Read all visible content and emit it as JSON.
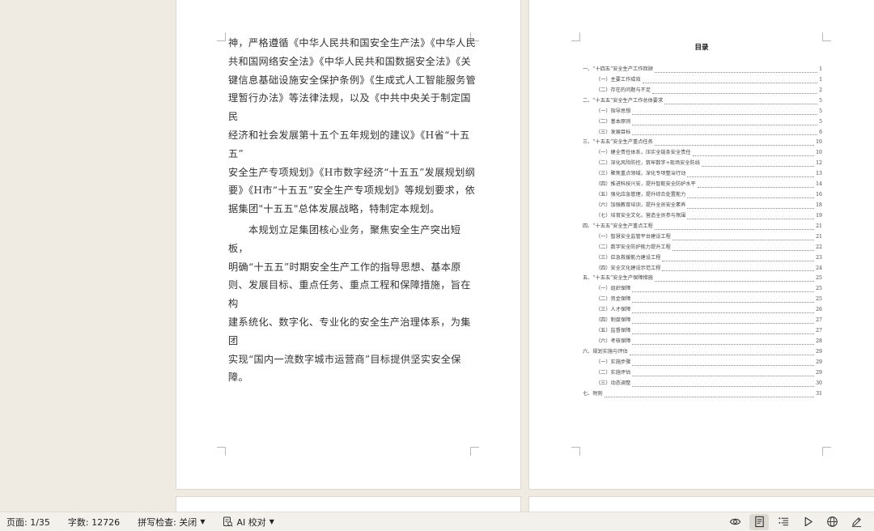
{
  "document": {
    "left_page": {
      "paragraphs": [
        "神，严格遵循《中华人民共和国安全生产法》《中华人民共和国网络安全法》《中华人民共和国数据安全法》《关键信息基础设施安全保护条例》《生成式人工智能服务管理暂行办法》等法律法规，以及《中共中央关于制定国民经济和社会发展第十五个五年规划的建议》《H省“十五五”安全生产专项规划》《H市数字经济“十五五”发展规划纲要》《H市“十五五”安全生产专项规划》等规划要求，依据集团\"十五五\"总体发展战略，特制定本规划。",
        "　　本规划立足集团核心业务，聚焦安全生产突出短板，明确“十五五”时期安全生产工作的指导思想、基本原则、发展目标、重点任务、重点工程和保障措施，旨在构建系统化、数字化、专业化的安全生产治理体系，为集团实现“国内一流数字城市运营商”目标提供坚实安全保障。"
      ],
      "lines": [
        "神，严格遵循《中华人民共和国安全生产法》《中华人民",
        "共和国网络安全法》《中华人民共和国数据安全法》《关",
        "键信息基础设施安全保护条例》《生成式人工智能服务管",
        "理暂行办法》等法律法规，以及《中共中央关于制定国民",
        "经济和社会发展第十五个五年规划的建议》《H省“十五五”",
        "安全生产专项规划》《H市数字经济“十五五”发展规划纲",
        "要》《H市“十五五”安全生产专项规划》等规划要求，依",
        "据集团\"十五五\"总体发展战略，特制定本规划。",
        "　　本规划立足集团核心业务，聚焦安全生产突出短板，",
        "明确“十五五”时期安全生产工作的指导思想、基本原",
        "则、发展目标、重点任务、重点工程和保障措施，旨在构",
        "建系统化、数字化、专业化的安全生产治理体系，为集团",
        "实现“国内一流数字城市运营商”目标提供坚实安全保",
        "障。"
      ]
    },
    "right_page": {
      "toc_title": "目录",
      "toc": [
        {
          "label": "一、“十四五”安全生产工作回顾",
          "page": "1",
          "level": 1
        },
        {
          "label": "（一）主要工作成效",
          "page": "1",
          "level": 2
        },
        {
          "label": "（二）存在的问题与不足",
          "page": "2",
          "level": 2
        },
        {
          "label": "二、“十五五”安全生产工作总体要求",
          "page": "5",
          "level": 1
        },
        {
          "label": "（一）指导思想",
          "page": "5",
          "level": 2
        },
        {
          "label": "（二）基本原则",
          "page": "5",
          "level": 2
        },
        {
          "label": "（三）发展目标",
          "page": "6",
          "level": 2
        },
        {
          "label": "三、“十五五”安全生产重点任务",
          "page": "10",
          "level": 1
        },
        {
          "label": "（一）健全责任体系，压实全链条安全责任",
          "page": "10",
          "level": 2
        },
        {
          "label": "（二）深化风险防控，筑牢数字+现场安全防线",
          "page": "12",
          "level": 2
        },
        {
          "label": "（三）聚焦重点领域，深化专项整治行动",
          "page": "13",
          "level": 2
        },
        {
          "label": "（四）推进科技兴安，提升智能安全防护水平",
          "page": "14",
          "level": 2
        },
        {
          "label": "（五）强化应急管理，提升综合处置能力",
          "page": "16",
          "level": 2
        },
        {
          "label": "（六）加强教育培训，提升全员安全素养",
          "page": "18",
          "level": 2
        },
        {
          "label": "（七）培育安全文化，营造全员参与氛围",
          "page": "19",
          "level": 2
        },
        {
          "label": "四、“十五五”安全生产重点工程",
          "page": "21",
          "level": 1
        },
        {
          "label": "（一）智慧安全监管平台建设工程",
          "page": "21",
          "level": 2
        },
        {
          "label": "（二）数字安全防护能力提升工程",
          "page": "22",
          "level": 2
        },
        {
          "label": "（三）应急救援能力建设工程",
          "page": "23",
          "level": 2
        },
        {
          "label": "（四）安全文化建设示范工程",
          "page": "24",
          "level": 2
        },
        {
          "label": "五、“十五五”安全生产保障措施",
          "page": "25",
          "level": 1
        },
        {
          "label": "（一）组织保障",
          "page": "25",
          "level": 2
        },
        {
          "label": "（二）资金保障",
          "page": "25",
          "level": 2
        },
        {
          "label": "（三）人才保障",
          "page": "26",
          "level": 2
        },
        {
          "label": "（四）制度保障",
          "page": "27",
          "level": 2
        },
        {
          "label": "（五）监督保障",
          "page": "27",
          "level": 2
        },
        {
          "label": "（六）考核保障",
          "page": "28",
          "level": 2
        },
        {
          "label": "六、规划实施与评估",
          "page": "29",
          "level": 1
        },
        {
          "label": "（一）实施步骤",
          "page": "29",
          "level": 2
        },
        {
          "label": "（二）实施评估",
          "page": "29",
          "level": 2
        },
        {
          "label": "（三）动态调整",
          "page": "30",
          "level": 2
        },
        {
          "label": "七、附则",
          "page": "31",
          "level": 1
        }
      ]
    }
  },
  "statusbar": {
    "page_info": "页面: 1/35",
    "word_count": "字数: 12726",
    "spell_check": "拼写检查: 关闭",
    "ai_proofread": "AI 校对",
    "icons": [
      "eye-icon",
      "page-view-icon",
      "outline-view-icon",
      "play-icon",
      "web-globe-icon",
      "pen-icon"
    ]
  },
  "colors": {
    "background": "#efebe2",
    "page": "#ffffff",
    "statusbar": "#f3f1ec",
    "active_view": "#dcd9d2"
  }
}
